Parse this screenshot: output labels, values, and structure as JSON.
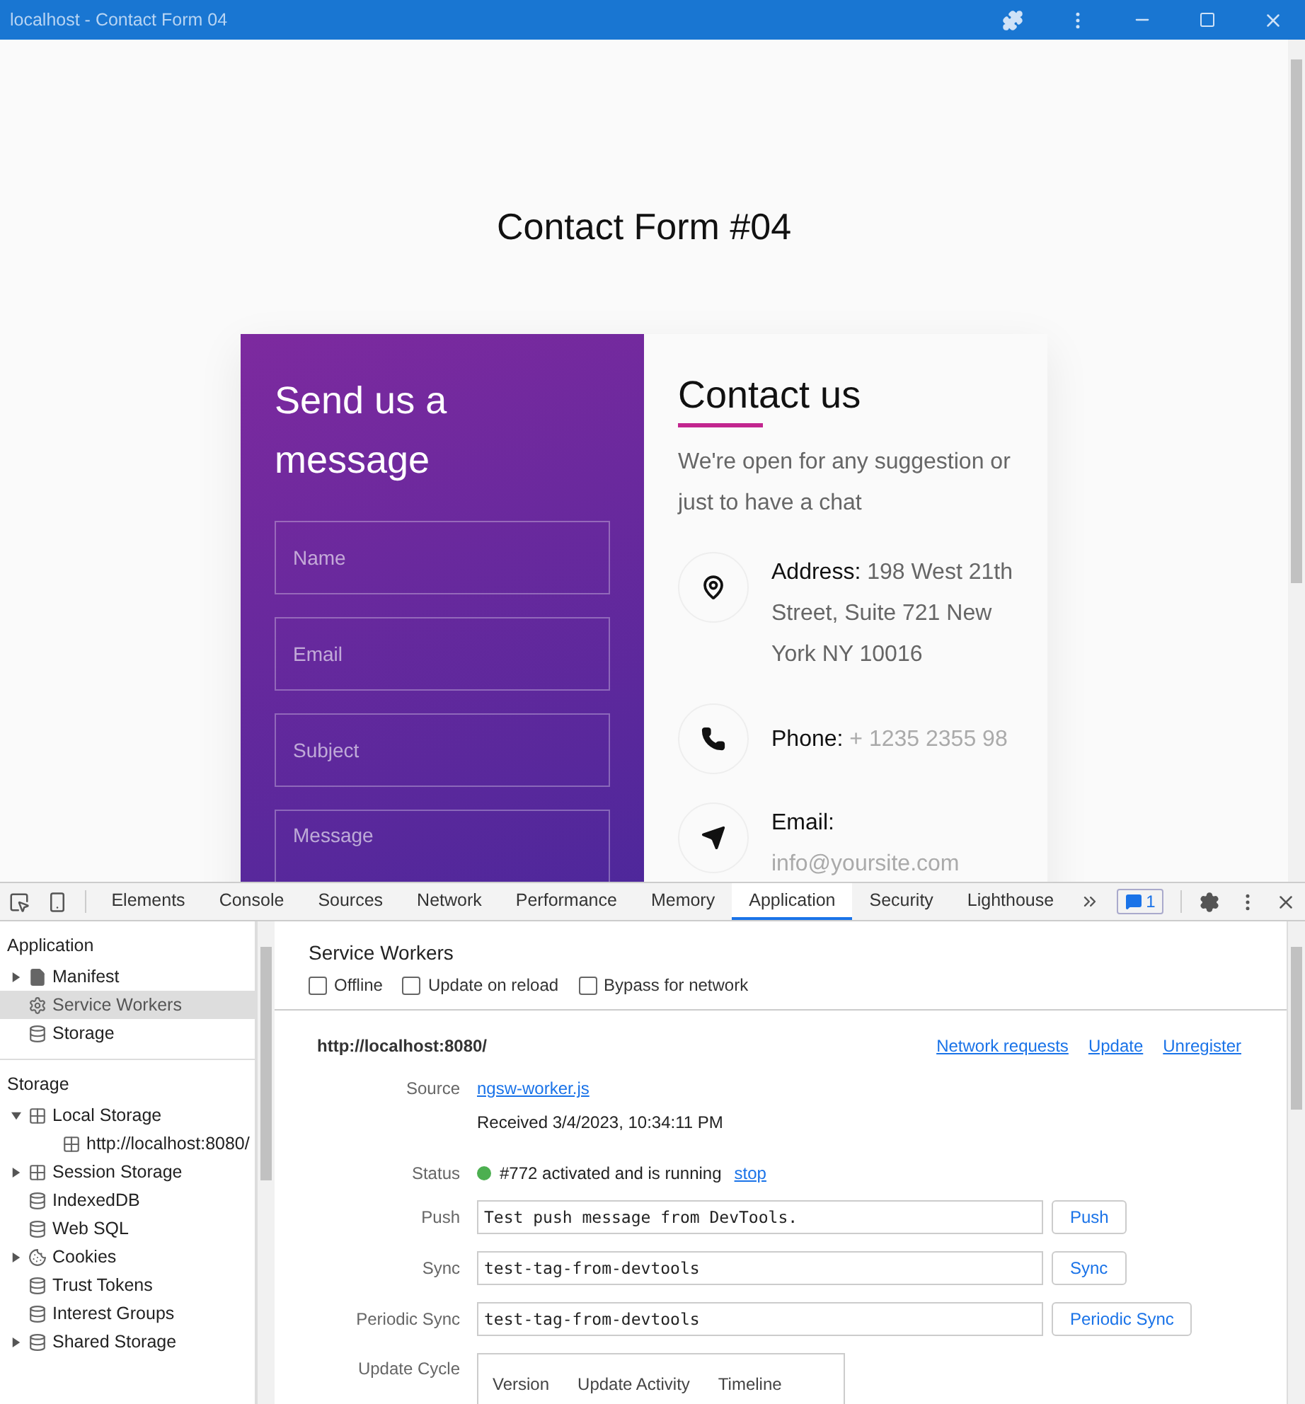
{
  "window": {
    "title": "localhost - Contact Form 04"
  },
  "page": {
    "heading": "Contact Form #04",
    "form": {
      "title": "Send us a message",
      "fields": [
        {
          "kind": "input",
          "placeholder": "Name"
        },
        {
          "kind": "input",
          "placeholder": "Email"
        },
        {
          "kind": "input",
          "placeholder": "Subject"
        },
        {
          "kind": "textarea",
          "placeholder": "Message"
        }
      ]
    },
    "contact": {
      "title": "Contact us",
      "intro": "We're open for any suggestion or just to have a chat",
      "items": [
        {
          "kind": "address",
          "label": "Address:",
          "value": "198 West 21th Street, Suite 721 New York NY 10016"
        },
        {
          "kind": "phone",
          "label": "Phone:",
          "value": "+ 1235 2355 98"
        },
        {
          "kind": "email",
          "label": "Email:",
          "value": "info@yoursite.com"
        }
      ]
    }
  },
  "devtools": {
    "tabs": [
      {
        "label": "Elements",
        "selected": false
      },
      {
        "label": "Console",
        "selected": false
      },
      {
        "label": "Sources",
        "selected": false
      },
      {
        "label": "Network",
        "selected": false
      },
      {
        "label": "Performance",
        "selected": false
      },
      {
        "label": "Memory",
        "selected": false
      },
      {
        "label": "Application",
        "selected": true
      },
      {
        "label": "Security",
        "selected": false
      },
      {
        "label": "Lighthouse",
        "selected": false
      }
    ],
    "issues_count": "1",
    "sidebar": [
      {
        "title": "Application",
        "items": [
          {
            "label": "Manifest",
            "kind": "file",
            "expanded": false,
            "selected": false
          },
          {
            "label": "Service Workers",
            "kind": "gear",
            "selected": true
          },
          {
            "label": "Storage",
            "kind": "db",
            "selected": false
          }
        ]
      },
      {
        "title": "Storage",
        "items": [
          {
            "label": "Local Storage",
            "kind": "grid",
            "expanded": true,
            "selected": false,
            "children": [
              {
                "label": "http://localhost:8080/",
                "kind": "grid",
                "selected": false
              }
            ]
          },
          {
            "label": "Session Storage",
            "kind": "grid",
            "expanded": false,
            "selected": false
          },
          {
            "label": "IndexedDB",
            "kind": "db",
            "selected": false
          },
          {
            "label": "Web SQL",
            "kind": "db",
            "selected": false
          },
          {
            "label": "Cookies",
            "kind": "cookie",
            "expanded": false,
            "selected": false
          },
          {
            "label": "Trust Tokens",
            "kind": "db",
            "selected": false
          },
          {
            "label": "Interest Groups",
            "kind": "db",
            "selected": false
          },
          {
            "label": "Shared Storage",
            "kind": "db",
            "expanded": false,
            "selected": false
          }
        ]
      }
    ],
    "panel": {
      "title": "Service Workers",
      "options": [
        {
          "label": "Offline",
          "checked": false
        },
        {
          "label": "Update on reload",
          "checked": false
        },
        {
          "label": "Bypass for network",
          "checked": false
        }
      ],
      "worker": {
        "origin": "http://localhost:8080/",
        "links": [
          "Network requests",
          "Update",
          "Unregister"
        ],
        "source": {
          "label": "Source",
          "link": "ngsw-worker.js",
          "received": "Received 3/4/2023, 10:34:11 PM"
        },
        "status": {
          "label": "Status",
          "color": "#4caf50",
          "text": "#772 activated and is running",
          "link": "stop"
        },
        "actions": [
          {
            "label": "Push",
            "value": "Test push message from DevTools.",
            "button": "Push"
          },
          {
            "label": "Sync",
            "value": "test-tag-from-devtools",
            "button": "Sync"
          },
          {
            "label": "Periodic Sync",
            "value": "test-tag-from-devtools",
            "button": "Periodic Sync"
          }
        ],
        "update_cycle": {
          "label": "Update Cycle",
          "columns": [
            "Version",
            "Update Activity",
            "Timeline"
          ]
        }
      }
    }
  }
}
